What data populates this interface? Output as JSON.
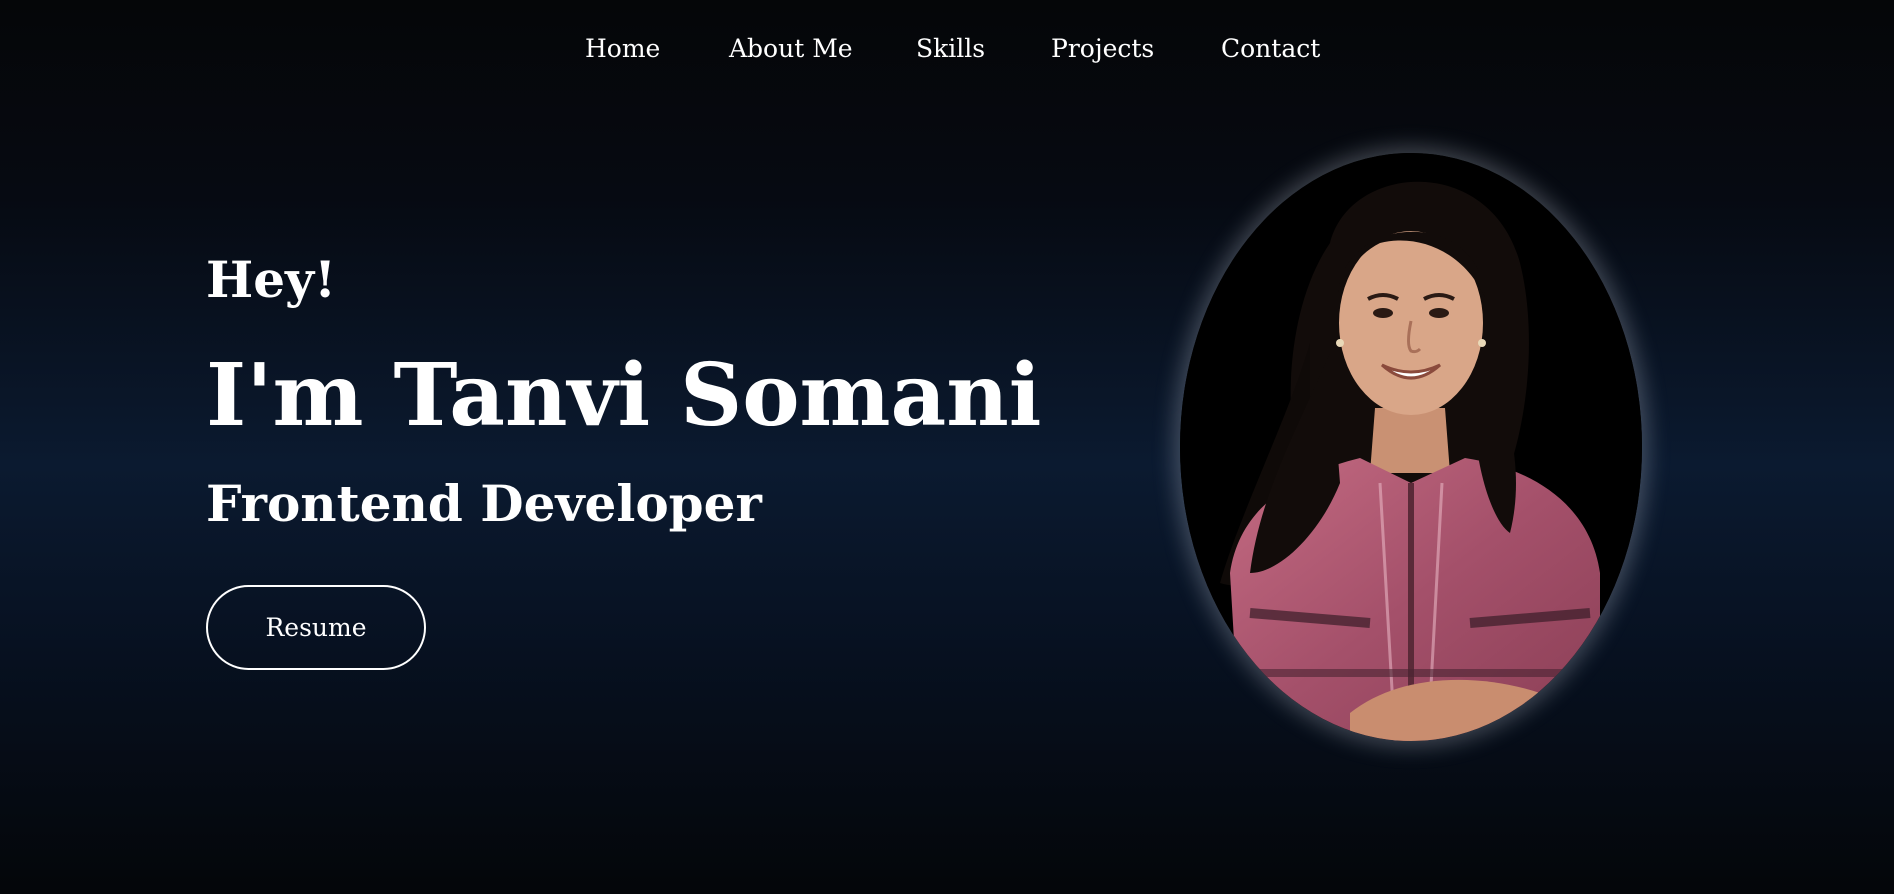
{
  "nav": {
    "items": [
      {
        "label": "Home"
      },
      {
        "label": "About Me"
      },
      {
        "label": "Skills"
      },
      {
        "label": "Projects"
      },
      {
        "label": "Contact"
      }
    ]
  },
  "hero": {
    "greeting": "Hey!",
    "name": "I'm Tanvi Somani",
    "role": "Frontend Developer",
    "resume_label": "Resume"
  },
  "colors": {
    "background_dark": "#050608",
    "background_mid": "#0b1a30",
    "text": "#ffffff",
    "outfit_pink": "#b35a72"
  }
}
